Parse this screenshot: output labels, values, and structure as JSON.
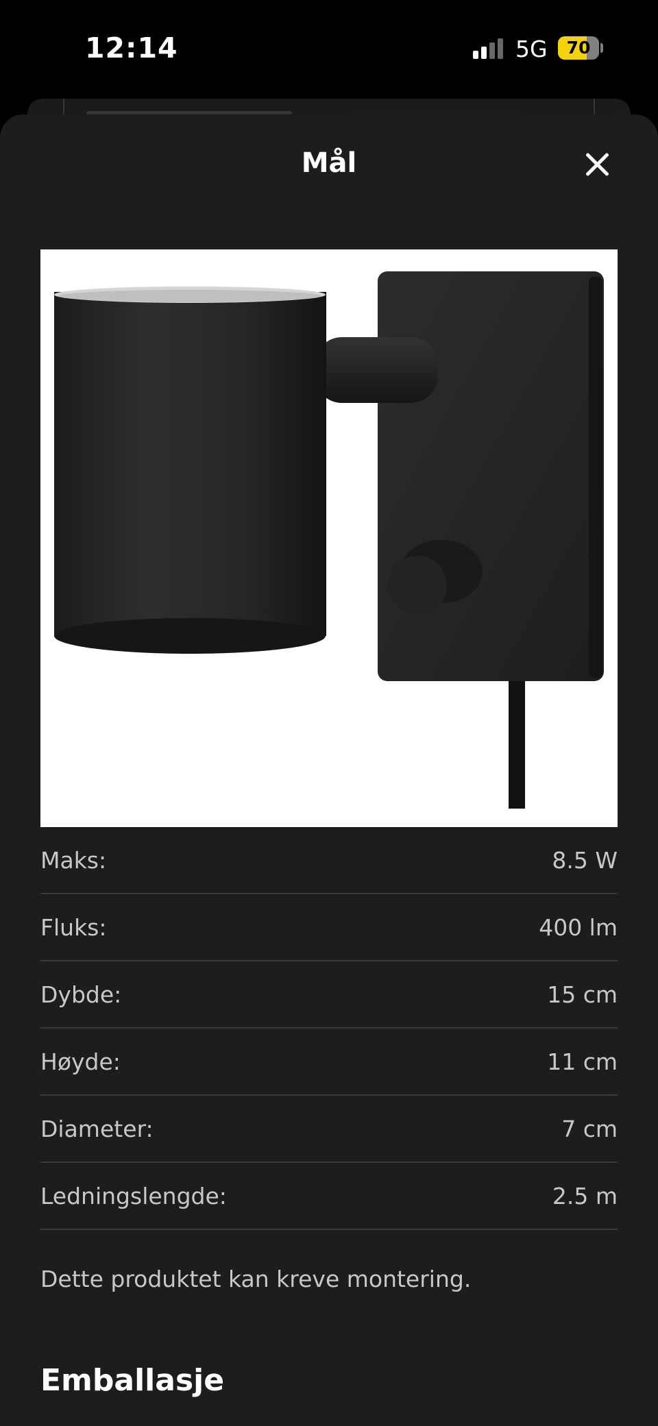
{
  "status_bar": {
    "time": "12:14",
    "network": "5G",
    "battery": "70",
    "battery_level": 0.7,
    "signal_bars_active": 2,
    "signal_bars_total": 4
  },
  "modal": {
    "title": "Mål",
    "close_icon": "close-icon",
    "image_alt": "black wall lamp"
  },
  "specs": [
    {
      "label": "Maks:",
      "value": "8.5 W"
    },
    {
      "label": "Fluks:",
      "value": "400 lm"
    },
    {
      "label": "Dybde:",
      "value": "15 cm"
    },
    {
      "label": "Høyde:",
      "value": "11 cm"
    },
    {
      "label": "Diameter:",
      "value": "7 cm"
    },
    {
      "label": "Ledningslengde:",
      "value": "2.5 m"
    }
  ],
  "note": "Dette produktet kan kreve montering.",
  "section_heading": "Emballasje",
  "colors": {
    "background": "#000000",
    "sheet": "#1d1d1f",
    "divider": "#3a3a3c",
    "battery_yellow": "#f5d20a"
  }
}
